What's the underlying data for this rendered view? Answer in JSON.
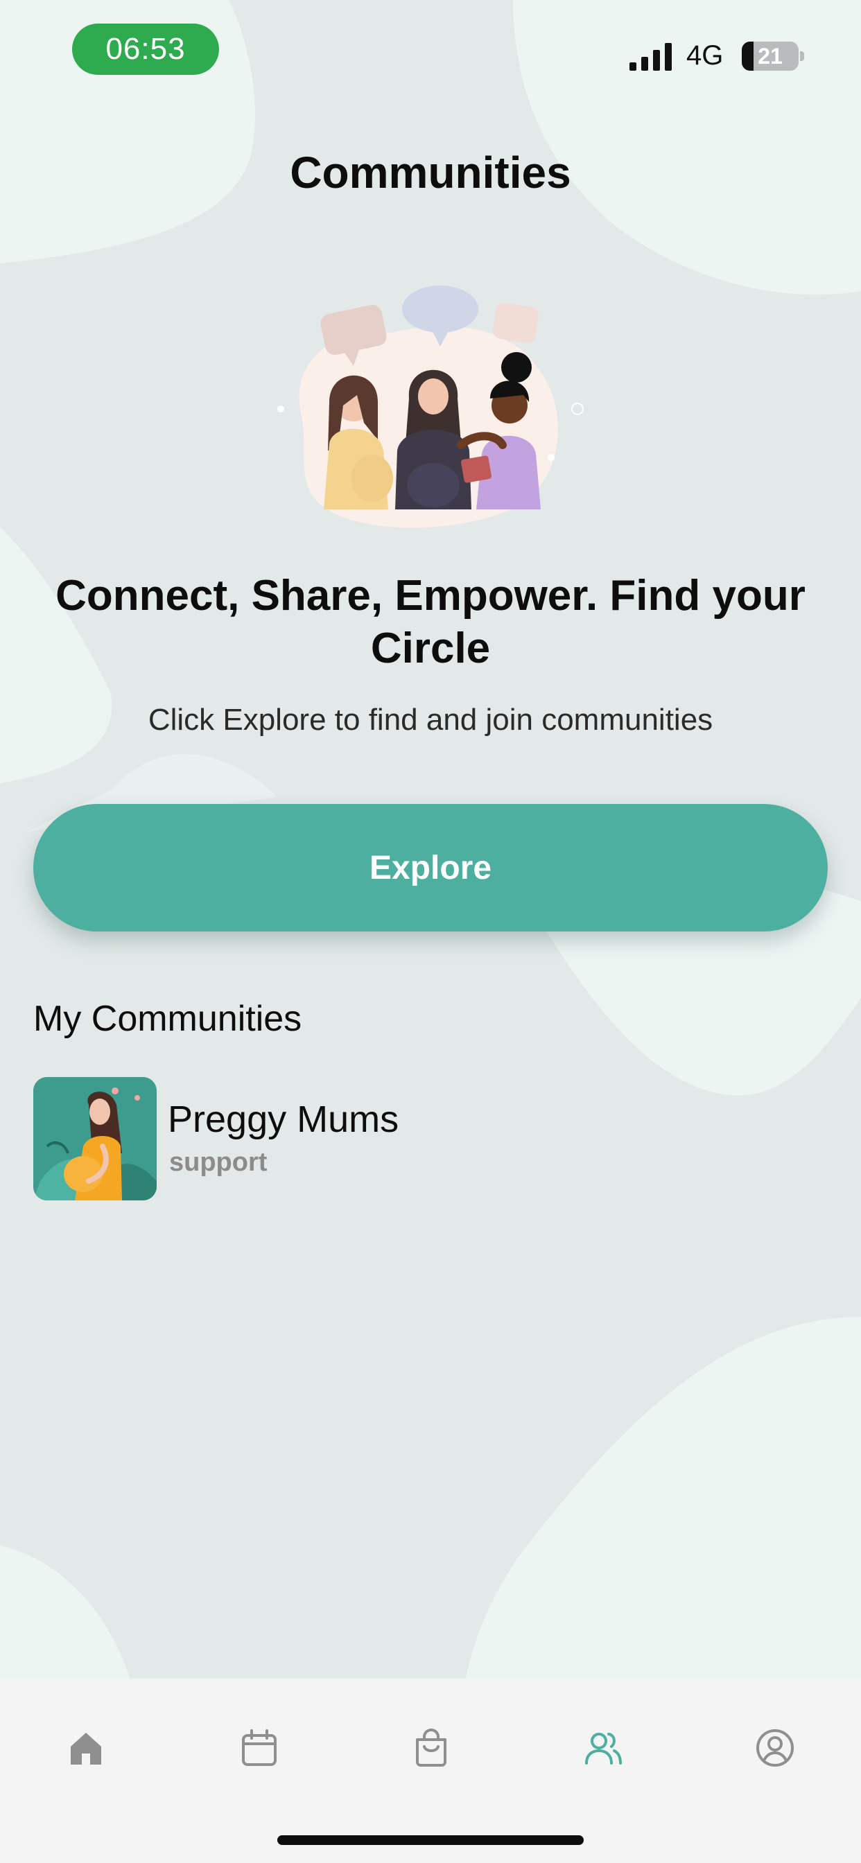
{
  "status_bar": {
    "time": "06:53",
    "network": "4G",
    "battery_level": "21",
    "battery_fraction": 0.21,
    "time_pill_color": "#2eaa4f"
  },
  "header": {
    "title": "Communities"
  },
  "hero": {
    "headline": "Connect, Share, Empower. Find your Circle",
    "subtitle": "Click Explore to find and join communities"
  },
  "explore_button": {
    "label": "Explore",
    "color": "#4caf9f"
  },
  "my_communities": {
    "title": "My Communities",
    "items": [
      {
        "name": "Preggy Mums",
        "tag": "support"
      }
    ]
  },
  "tab_bar": {
    "active_color": "#4caf9f",
    "inactive_color": "#8f8f8f",
    "tabs": [
      {
        "icon": "home-icon",
        "active": false
      },
      {
        "icon": "calendar-icon",
        "active": false
      },
      {
        "icon": "shopping-bag-icon",
        "active": false
      },
      {
        "icon": "people-icon",
        "active": true
      },
      {
        "icon": "profile-icon",
        "active": false
      }
    ]
  }
}
